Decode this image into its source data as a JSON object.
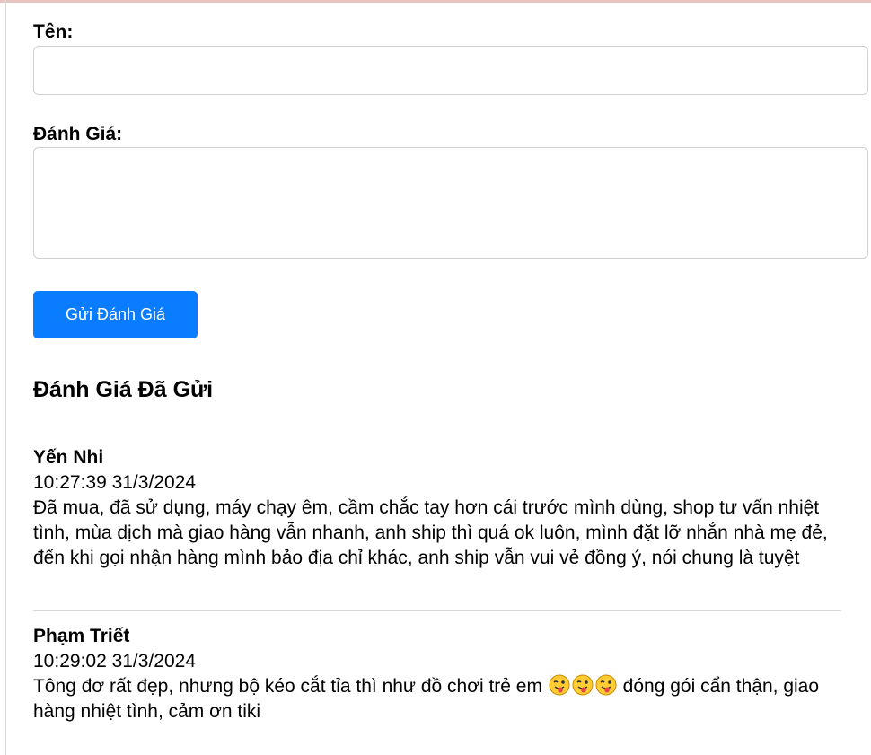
{
  "form": {
    "name_label": "Tên:",
    "name_value": "",
    "review_label": "Đánh Giá:",
    "review_value": "",
    "submit_label": "Gửi Đánh Giá"
  },
  "reviews_section": {
    "title": "Đánh Giá Đã Gửi",
    "items": [
      {
        "author": "Yến Nhi",
        "time": "10:27:39 31/3/2024",
        "text": "Đã mua, đã sử dụng, máy chạy êm, cầm chắc tay hơn cái trước mình dùng, shop tư vấn nhiệt tình, mùa dịch mà giao hàng vẫn nhanh, anh ship thì quá ok luôn, mình đặt lỡ nhắn nhà mẹ đẻ, đến khi gọi nhận hàng mình bảo địa chỉ khác, anh ship vẫn vui vẻ đồng ý, nói chung là tuyệt"
      },
      {
        "author": "Phạm Triết",
        "time": "10:29:02 31/3/2024",
        "text_before": "Tông đơ rất đẹp, nhưng bộ kéo cắt tỉa thì như đồ chơi trẻ em",
        "emojis": [
          "winking-face-with-tongue-icon",
          "winking-face-with-tongue-icon",
          "winking-face-with-tongue-icon"
        ],
        "text_after": "đóng gói cẩn thận, giao hàng nhiệt tình, cảm ơn tiki"
      }
    ]
  },
  "colors": {
    "button": "#0a7cff",
    "button_text": "#ffffff",
    "border": "#cfcfcf",
    "divider": "#d6d6d6"
  }
}
